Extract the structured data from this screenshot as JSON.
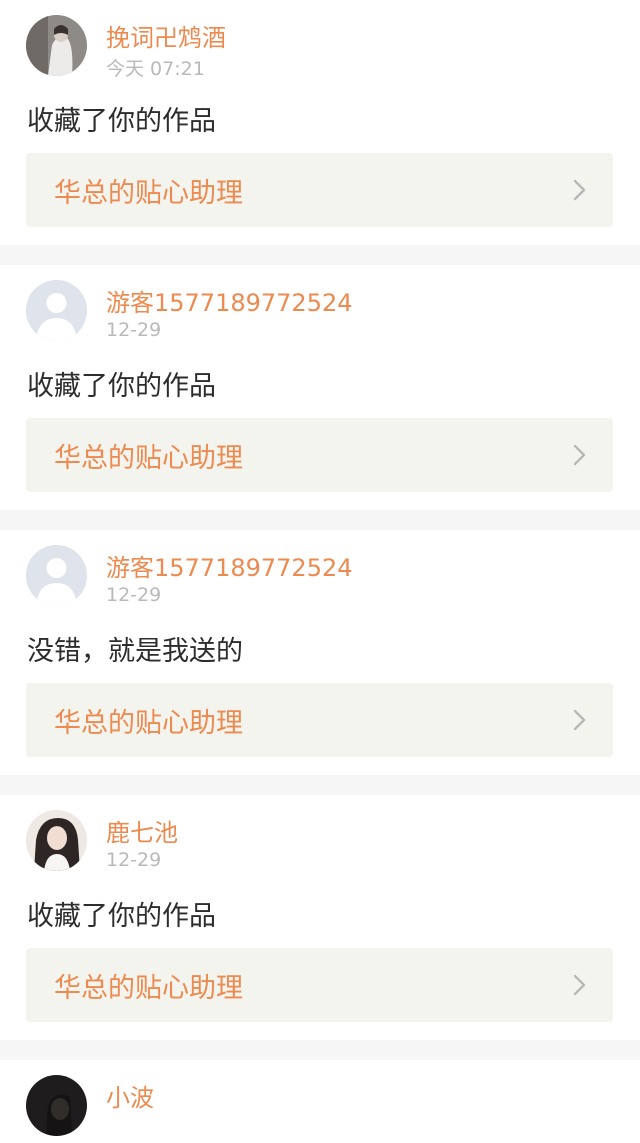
{
  "items": [
    {
      "avatar": "photo-avatar-white-dress",
      "username": "挽词卍鸩酒",
      "time": "今天 07:21",
      "message": "收藏了你的作品",
      "link": "华总的贴心助理"
    },
    {
      "avatar": "default-user-avatar",
      "username": "游客1577189772524",
      "time": "12-29",
      "message": "收藏了你的作品",
      "link": "华总的贴心助理"
    },
    {
      "avatar": "default-user-avatar",
      "username": "游客1577189772524",
      "time": "12-29",
      "message": "没错，就是我送的",
      "link": "华总的贴心助理"
    },
    {
      "avatar": "photo-avatar-long-hair",
      "username": "鹿七池",
      "time": "12-29",
      "message": "收藏了你的作品",
      "link": "华总的贴心助理"
    },
    {
      "avatar": "photo-avatar-dark-hair",
      "username": "小波"
    }
  ],
  "colors": {
    "accent": "#ec8a4f",
    "box": "#f4f4ef",
    "divider": "#f6f6f6"
  }
}
